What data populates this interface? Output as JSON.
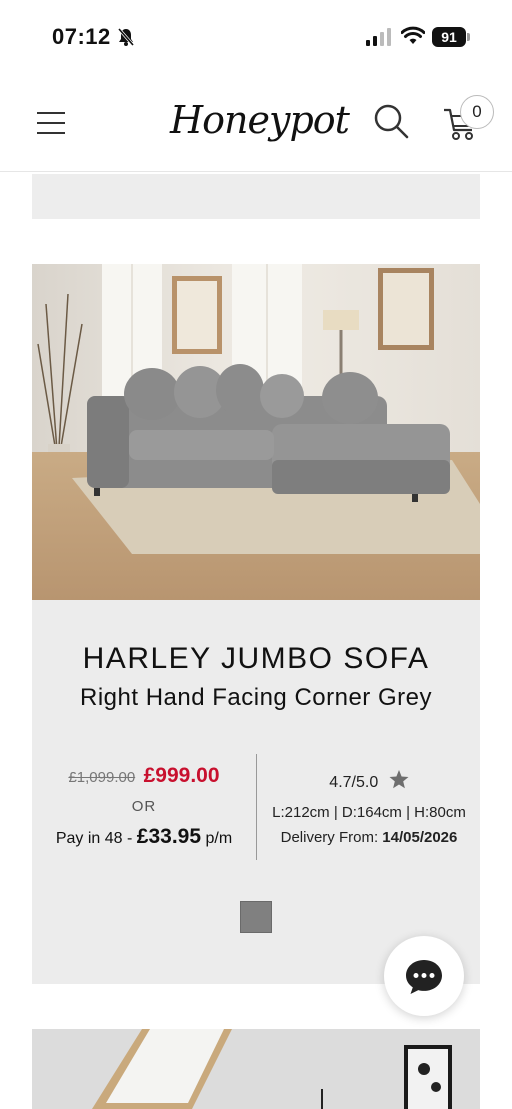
{
  "status_bar": {
    "time": "07:12",
    "battery": "91",
    "icons": [
      "bell-slash-icon",
      "signal-icon",
      "wifi-icon",
      "battery-icon"
    ]
  },
  "header": {
    "logo_text": "Honeypot",
    "cart_count": "0",
    "icons": [
      "hamburger-menu-icon",
      "search-icon",
      "cart-icon"
    ]
  },
  "product": {
    "name": "HARLEY JUMBO SOFA",
    "subtitle": "Right Hand Facing Corner Grey",
    "old_price": "£1,099.00",
    "price": "£999.00",
    "or_label": "OR",
    "finance_prefix": "Pay in 48 -",
    "finance_amount": "£33.95",
    "finance_suffix": "p/m",
    "rating": "4.7/5.0",
    "dimensions": "L:212cm | D:164cm | H:80cm",
    "delivery_label": "Delivery From:",
    "delivery_date": "14/05/2026",
    "swatch_color": "#808080"
  },
  "colors": {
    "sale_red": "#c8102e",
    "card_bg": "#ececec"
  }
}
